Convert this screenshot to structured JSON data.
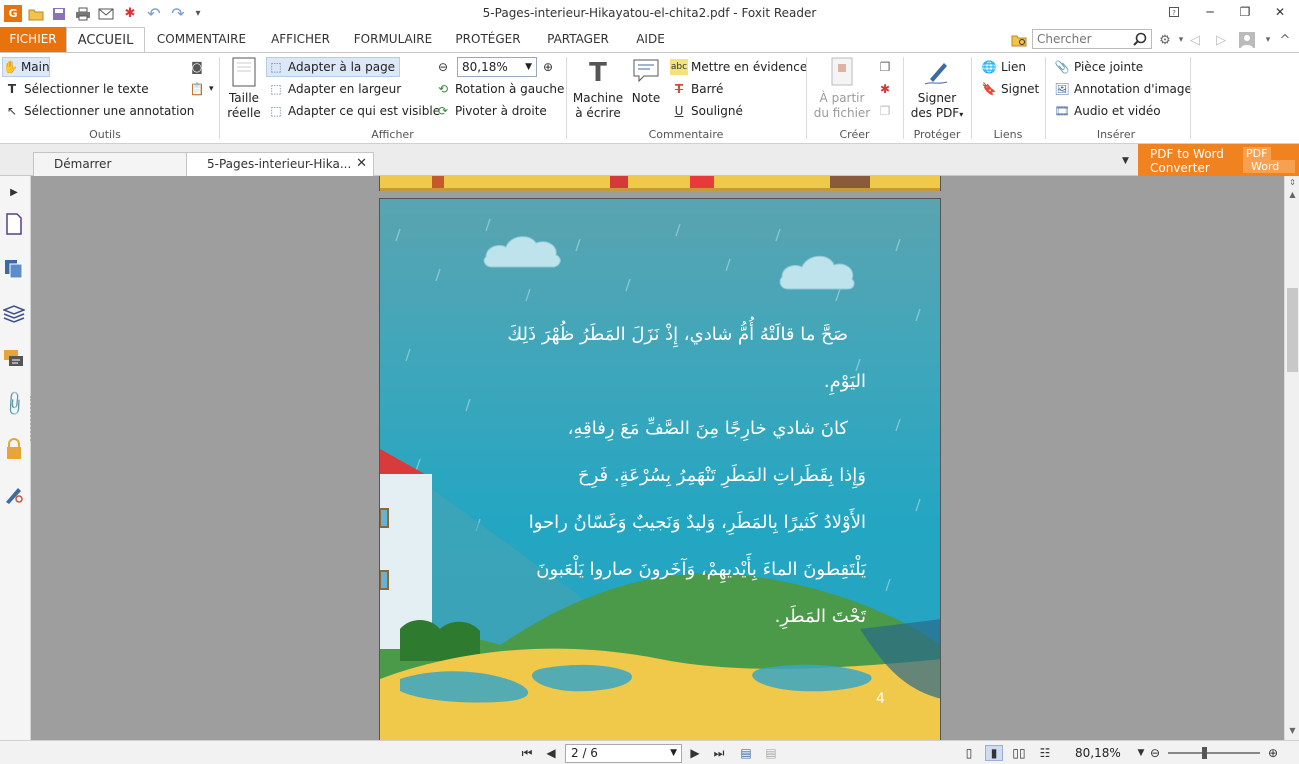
{
  "window": {
    "title": "5-Pages-interieur-Hikayatou-el-chita2.pdf - Foxit Reader",
    "help_icon": "?",
    "minimize_icon": "─",
    "restore_icon": "❐",
    "close_icon": "✕"
  },
  "quick_access": {
    "app_icon": "G",
    "open_icon": "📂",
    "save_icon": "💾",
    "print_icon": "🖶",
    "undo_icon": "↶",
    "redo_icon": "↷",
    "more_icon": "▾"
  },
  "ribbon_tabs": [
    "FICHIER",
    "ACCUEIL",
    "COMMENTAIRE",
    "AFFICHER",
    "FORMULAIRE",
    "PROTÉGER",
    "PARTAGER",
    "AIDE"
  ],
  "search": {
    "placeholder": "Chercher"
  },
  "groups": {
    "outils": {
      "label": "Outils",
      "main": "Main",
      "select_text": "Sélectionner le texte",
      "select_annotation": "Sélectionner une annotation"
    },
    "afficher": {
      "label": "Afficher",
      "taille_reelle_1": "Taille",
      "taille_reelle_2": "réelle",
      "fit_page": "Adapter à la page",
      "fit_width": "Adapter en largeur",
      "fit_visible": "Adapter ce qui est visible",
      "zoom_value": "80,18%",
      "rotate_left": "Rotation à gauche",
      "rotate_right": "Pivoter à droite"
    },
    "commentaire": {
      "label": "Commentaire",
      "typewriter_1": "Machine",
      "typewriter_2": "à écrire",
      "note": "Note",
      "highlight": "Mettre en évidence",
      "strikeout": "Barré",
      "underline": "Souligné"
    },
    "creer": {
      "label": "Créer",
      "from_file_1": "À partir",
      "from_file_2": "du fichier"
    },
    "proteger": {
      "label": "Protéger",
      "sign_1": "Signer",
      "sign_2": "des PDF"
    },
    "liens": {
      "label": "Liens",
      "link": "Lien",
      "bookmark": "Signet"
    },
    "inserer": {
      "label": "Insérer",
      "attachment": "Pièce jointe",
      "image_annotation": "Annotation d'image",
      "audio_video": "Audio et vidéo"
    }
  },
  "doc_tabs": [
    {
      "label": "Démarrer"
    },
    {
      "label": "5-Pages-interieur-Hika..."
    }
  ],
  "promo": {
    "line1": "PDF to Word",
    "line2": "Converter",
    "badge1": "PDF",
    "badge2": "Word"
  },
  "page": {
    "lines": [
      "صَحَّ ما قالَتْهُ أُمُّ شادي، إِذْ نَزَلَ المَطَرُ ظُهْرَ ذَلِكَ",
      "اليَوْمِ.",
      "كانَ شادي خارِجًا مِنَ الصَّفِّ مَعَ رِفاقِهِ،",
      "وَإِذا بِقَطَراتِ المَطَرِ تَنْهَمِرُ بِسُرْعَةٍ. فَرِحَ",
      "الأَوْلادُ كَثيرًا بِالمَطَرِ، وَليدٌ وَنَجيبٌ وَغَسّانُ راحوا",
      "يَلْتَقِطونَ الماءَ بِأَيْديهِمْ، وَآخَرونَ صاروا يَلْعَبونَ",
      "تَحْتَ المَطَرِ."
    ],
    "number": "4"
  },
  "status": {
    "page_field": "2 / 6",
    "zoom": "80,18%"
  },
  "colors": {
    "accent": "#e8720c",
    "promo": "#f08220",
    "sea": "#23a6c2",
    "sand": "#f0c84a"
  }
}
